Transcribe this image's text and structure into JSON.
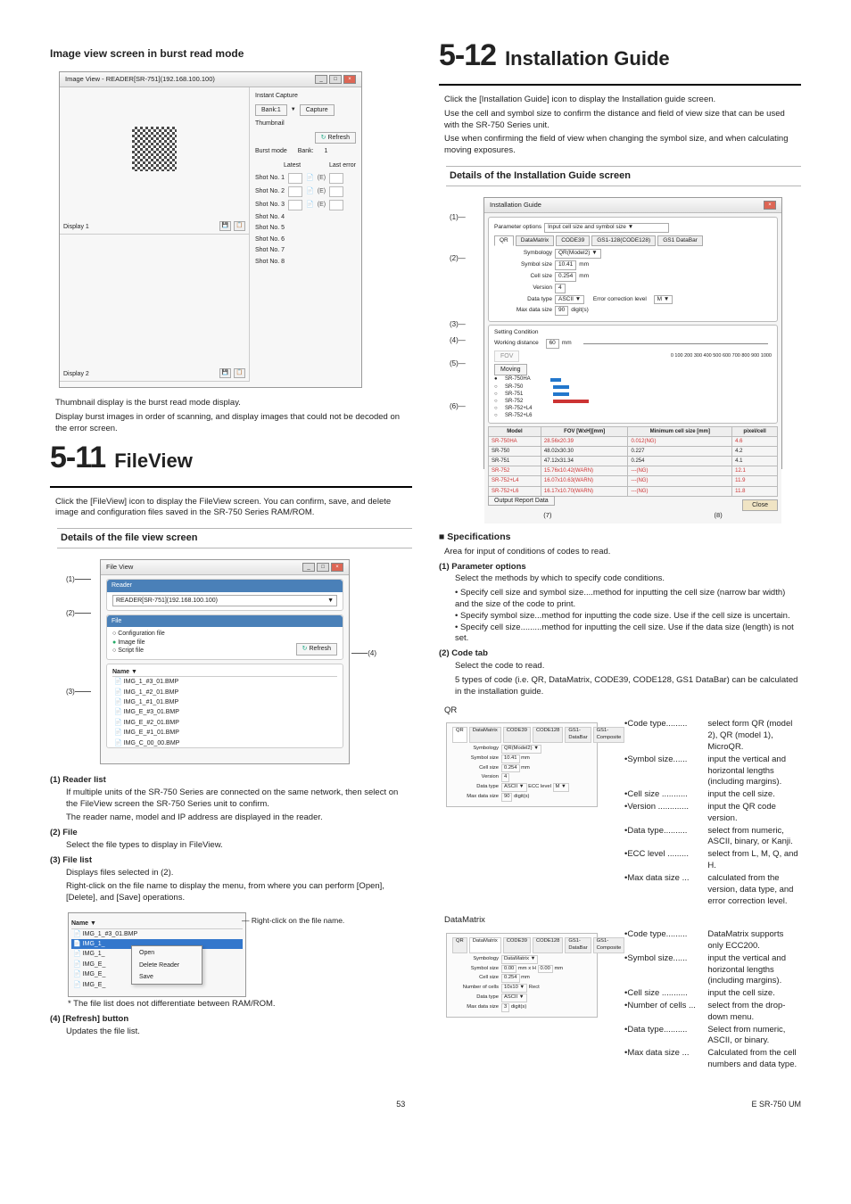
{
  "left": {
    "h2_image_view": "Image view screen in burst read mode",
    "burst": {
      "title": "Image View - READER[SR-751](192.168.100.100)",
      "instant_capture": "Instant Capture",
      "bank_label": "Bank:1",
      "capture": "Capture",
      "thumbnail": "Thumbnail",
      "refresh": "Refresh",
      "burst_mode": "Burst mode",
      "bank": "Bank:",
      "bank_val": "1",
      "latest": "Latest",
      "last_error": "Last error",
      "shots": [
        "Shot No. 1",
        "Shot No. 2",
        "Shot No. 3",
        "Shot No. 4",
        "Shot No. 5",
        "Shot No. 6",
        "Shot No. 7",
        "Shot No. 8"
      ],
      "err_e": "(E)",
      "display1": "Display 1",
      "display2": "Display 2"
    },
    "burst_desc1": "Thumbnail display is the burst read mode display.",
    "burst_desc2": "Display burst images in order of scanning, and display images that could not be decoded on the error screen.",
    "ch511_num": "5-11",
    "ch511_title": "FileView",
    "ch511_body": "Click the [FileView] icon to display the FileView screen. You can confirm, save, and delete image and configuration files saved in the SR-750 Series RAM/ROM.",
    "h3_fileview": "Details of the file view screen",
    "fv": {
      "title": "File View",
      "reader_hdr": "Reader",
      "reader_val": "READER[SR-751](192.168.100.100)",
      "file_hdr": "File",
      "opt_config": "Configuration file",
      "opt_image": "Image file",
      "opt_script": "Script file",
      "refresh": "Refresh",
      "name_col": "Name",
      "files": [
        "IMG_1_#3_01.BMP",
        "IMG_1_#2_01.BMP",
        "IMG_1_#1_01.BMP",
        "IMG_E_#3_01.BMP",
        "IMG_E_#2_01.BMP",
        "IMG_E_#1_01.BMP",
        "IMG_C_00_00.BMP"
      ]
    },
    "fv_cl1": "(1)",
    "fv_cl2": "(2)",
    "fv_cl3": "(3)",
    "fv_cl4": "(4)",
    "fv1_t": "(1) Reader list",
    "fv1_b1": "If multiple units of the SR-750 Series are connected on the same network, then select on the FileView screen the SR-750 Series unit to confirm.",
    "fv1_b2": "The reader name, model and IP address are displayed in the reader.",
    "fv2_t": "(2) File",
    "fv2_b": "Select the file types to display in FileView.",
    "fv3_t": "(3) File list",
    "fv3_b1": "Displays files selected in (2).",
    "fv3_b2": "Right-click on the file name to display the menu, from where you can perform [Open], [Delete], and [Save] operations.",
    "ctx": {
      "name_col": "Name",
      "rows": [
        "IMG_1_#3_01.BMP",
        "IMG_1_",
        "IMG_1_",
        "IMG_E_",
        "IMG_E_",
        "IMG_E_"
      ],
      "menu": [
        "Open",
        "Delete Reader",
        "Save"
      ],
      "note": "Right-click on the file name."
    },
    "ctx_foot": "* The file list does not differentiate between RAM/ROM.",
    "fv4_t": "(4) [Refresh] button",
    "fv4_b": "Updates the file list."
  },
  "right": {
    "ch512_num": "5-12",
    "ch512_title": "Installation Guide",
    "ch512_b1": "Click the [Installation Guide] icon to display the Installation guide screen.",
    "ch512_b2": "Use the cell and symbol size to confirm the distance and field of view size that can be used with the SR-750 Series unit.",
    "ch512_b3": "Use when confirming the field of view when changing the symbol size, and when calculating moving exposures.",
    "h3_install": "Details of the Installation Guide screen",
    "ig": {
      "title": "Installation Guide",
      "param_opt": "Parameter options",
      "param_val": "Input cell size and symbol size",
      "tabs": [
        "QR",
        "DataMatrix",
        "CODE39",
        "GS1-128(CODE128)",
        "GS1 DataBar"
      ],
      "symbology_l": "Symbology",
      "symbology_v": "QR(Model2)",
      "symbol_size_l": "Symbol size",
      "symbol_size_v": "10.41",
      "mm": "mm",
      "cell_size_l": "Cell size",
      "cell_size_v": "0.254",
      "version_l": "Version",
      "version_v": "4",
      "data_type_l": "Data type",
      "data_type_v": "ASCII",
      "ecc_l": "Error correction level",
      "ecc_v": "M",
      "max_l": "Max data size",
      "max_v": "90",
      "digits": "digit(s)",
      "setting_condition": "Setting Condition",
      "wd_l": "Working distance",
      "wd_v": "60",
      "fov": "FOV",
      "moving": "Moving",
      "models": [
        "SR-750HA",
        "SR-750",
        "SR-751",
        "SR-752",
        "SR-752+L4",
        "SR-752+L6"
      ],
      "scale": "0  100  200  300  400  500  600  700  800  900 1000",
      "tbl_h": [
        "Model",
        "FOV [WxH][mm]",
        "Minimum cell size [mm]",
        "pixel/cell"
      ],
      "tbl": [
        {
          "m": "SR-750HA",
          "f": "28.56x20.39",
          "c": "0.012(NG)",
          "p": "4.6",
          "r": true
        },
        {
          "m": "SR-750",
          "f": "48.02x30.30",
          "c": "0.227",
          "p": "4.2",
          "r": false
        },
        {
          "m": "SR-751",
          "f": "47.12x31.34",
          "c": "0.254",
          "p": "4.1",
          "r": false
        },
        {
          "m": "SR-752",
          "f": "15.76x10.42(WARN)",
          "c": "---(NG)",
          "p": "12.1",
          "r": true
        },
        {
          "m": "SR-752+L4",
          "f": "16.07x10.63(WARN)",
          "c": "---(NG)",
          "p": "11.9",
          "r": true
        },
        {
          "m": "SR-752+L6",
          "f": "16.17x10.70(WARN)",
          "c": "---(NG)",
          "p": "11.8",
          "r": true
        }
      ],
      "output": "Output Report Data",
      "close": "Close"
    },
    "spec_head": "Specifications",
    "spec_area": "Area for input of conditions of codes to read.",
    "p1_t": "(1) Parameter options",
    "p1_b": "Select the methods by which to specify code conditions.",
    "p1_s1a": "Specify cell size and symbol size",
    "p1_s1b": "....method for inputting the cell size (narrow bar width) and the size of the code to print.",
    "p1_s2a": "Specify symbol size",
    "p1_s2b": "...method for inputting the code size. Use if the cell size is uncertain.",
    "p1_s3a": "Specify cell size",
    "p1_s3b": ".........method for inputting the cell size. Use if the data size (length) is not set.",
    "p2_t": "(2) Code tab",
    "p2_b1": "Select the code to read.",
    "p2_b2": "5 types of code (i.e. QR, DataMatrix, CODE39, CODE128, GS1 DataBar) can be calculated in the installation guide.",
    "qr_head": "QR",
    "qr_panel": {
      "tabs": [
        "QR",
        "DataMatrix",
        "CODE39",
        "CODE128",
        "GS1-DataBar",
        "GS1-Composite"
      ],
      "symbology": "Symbology",
      "symbology_v": "QR(Model2)",
      "symbol_size": "Symbol size",
      "symbol_size_v": "10.41",
      "mm": "mm",
      "cell_size": "Cell size",
      "cell_size_v": "0.254",
      "version": "Version",
      "version_v": "4",
      "data_type": "Data type",
      "data_type_v": "ASCII",
      "ecc": "ECC level",
      "ecc_v": "M",
      "max": "Max data size",
      "max_v": "90",
      "digits": "digit(s)"
    },
    "qr_params": [
      {
        "n": "Code type.........",
        "d": "select form QR (model 2), QR (model 1), MicroQR."
      },
      {
        "n": "Symbol size......",
        "d": "input the vertical and horizontal lengths (including margins)."
      },
      {
        "n": "Cell size ...........",
        "d": "input the cell size."
      },
      {
        "n": "Version .............",
        "d": "input the QR code version."
      },
      {
        "n": "Data type..........",
        "d": "select from numeric, ASCII, binary, or Kanji."
      },
      {
        "n": "ECC level .........",
        "d": "select from L, M, Q, and H."
      },
      {
        "n": "Max data size ...",
        "d": "calculated from the version, data type, and error correction level."
      }
    ],
    "dm_head": "DataMatrix",
    "dm_panel": {
      "tabs": [
        "QR",
        "DataMatrix",
        "CODE39",
        "CODE128",
        "GS1-DataBar",
        "GS1-Composite"
      ],
      "symbology": "Symbology",
      "symbology_v": "DataMatrix",
      "symbol_size": "Symbol size",
      "sw": "0.00",
      "swh": "mm x H",
      "sh": "0.00",
      "mm": "mm",
      "cell_size": "Cell size",
      "cell_size_v": "0.254",
      "numcells": "Number of cells",
      "numcells_v": "10x10",
      "rect": "Rect",
      "data_type": "Data type",
      "data_type_v": "ASCII",
      "max": "Max data size",
      "max_v": "3",
      "digits": "digit(s)"
    },
    "dm_params": [
      {
        "n": "Code type.........",
        "d": "DataMatrix supports only ECC200."
      },
      {
        "n": "Symbol size......",
        "d": "input the vertical and horizontal lengths (including margins)."
      },
      {
        "n": "Cell size ...........",
        "d": "input the cell size."
      },
      {
        "n": "Number of cells ...",
        "d": "select from the drop-down menu."
      },
      {
        "n": "Data type..........",
        "d": "Select from numeric, ASCII, or binary."
      },
      {
        "n": "Max data size ...",
        "d": "Calculated from the cell numbers and data type."
      }
    ]
  },
  "footer": {
    "page": "53",
    "doc": "E SR-750 UM"
  }
}
